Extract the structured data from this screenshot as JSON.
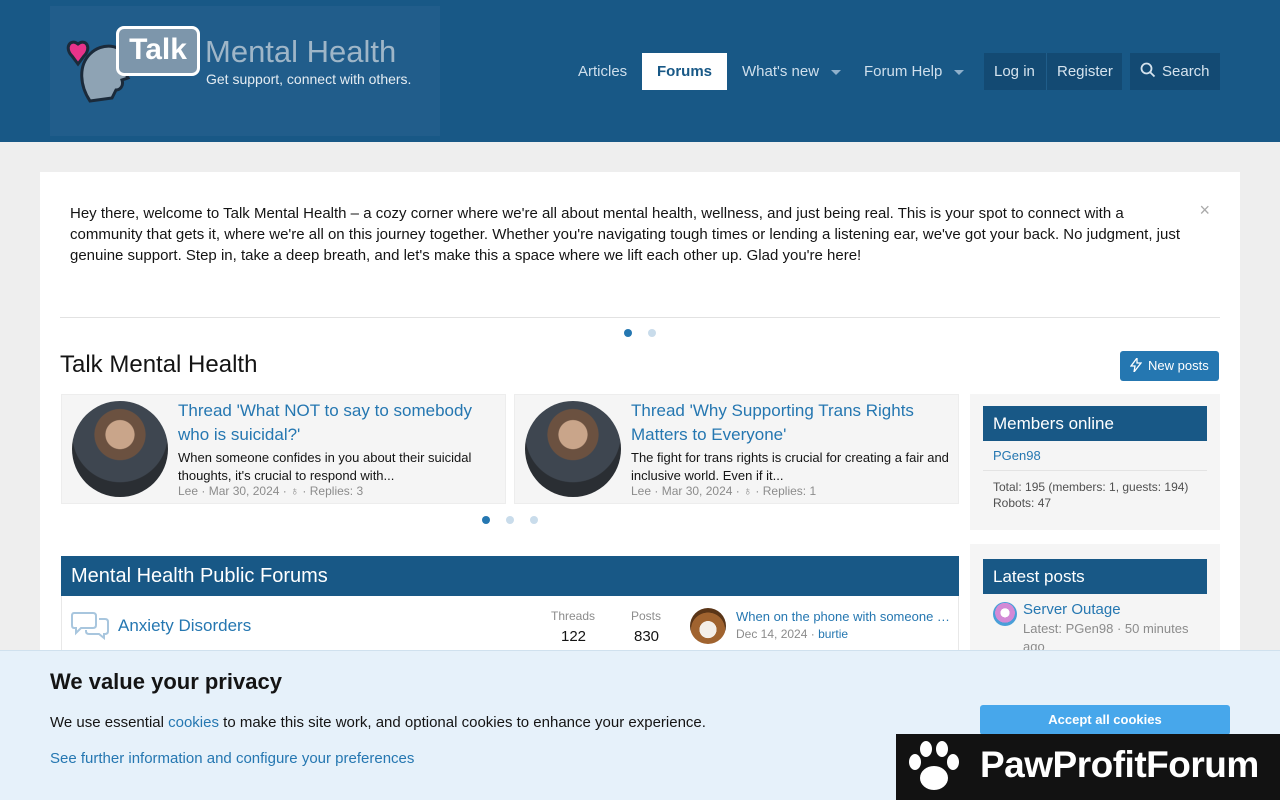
{
  "brand": {
    "bubble": "Talk",
    "name": "Mental Health",
    "tagline": "Get support, connect with others."
  },
  "nav": {
    "articles": "Articles",
    "forums": "Forums",
    "whats_new": "What's new",
    "forum_help": "Forum Help",
    "login": "Log in",
    "register": "Register",
    "search": "Search"
  },
  "notice": {
    "text": "Hey there, welcome to Talk Mental Health – a cozy corner where we're all about mental health, wellness, and just being real. This is your spot to connect with a community that gets it, where we're all on this journey together. Whether you're navigating tough times or lending a listening ear, we've got your back. No judgment, just genuine support. Step in, take a deep breath, and let's make this a space where we lift each other up. Glad you're here!",
    "close": "×"
  },
  "page": {
    "title": "Talk Mental Health",
    "new_posts": "New posts"
  },
  "featured": [
    {
      "title": "Thread 'What NOT to say to somebody who is suicidal?'",
      "snippet": "When someone confides in you about their suicidal thoughts, it's crucial to respond with...",
      "author": "Lee",
      "date": "Mar 30, 2024",
      "replies": "Replies: 3"
    },
    {
      "title": "Thread 'Why Supporting Trans Rights Matters to Everyone'",
      "snippet": "The fight for trans rights is crucial for creating a fair and inclusive world. Even if it...",
      "author": "Lee",
      "date": "Mar 30, 2024",
      "replies": "Replies: 1"
    }
  ],
  "members_online": {
    "title": "Members online",
    "member": "PGen98",
    "total": "Total: 195 (members: 1, guests: 194)",
    "robots": "Robots: 47"
  },
  "latest_posts": {
    "title": "Latest posts",
    "item_title": "Server Outage",
    "item_meta_1": "Latest: PGen98 · 50 minutes",
    "item_meta_2": "ago"
  },
  "forums": {
    "section_title": "Mental Health Public Forums",
    "rows": [
      {
        "name": "Anxiety Disorders",
        "threads_label": "Threads",
        "threads": "122",
        "posts_label": "Posts",
        "posts": "830",
        "last_title": "When on the phone with someone yo...",
        "last_date": "Dec 14, 2024",
        "last_user": "burtie"
      }
    ]
  },
  "cookie": {
    "title": "We value your privacy",
    "msg_before": "We use essential ",
    "msg_link": "cookies",
    "msg_after": " to make this site work, and optional cookies to enhance your experience.",
    "more": "See further information and configure your preferences",
    "accept": "Accept all cookies"
  },
  "watermark": {
    "text": "PawProfitForum"
  },
  "colors": {
    "header": "#185886",
    "accent": "#2577b1",
    "cookie_bg": "#e6f1fa",
    "accept": "#47a7eb"
  }
}
